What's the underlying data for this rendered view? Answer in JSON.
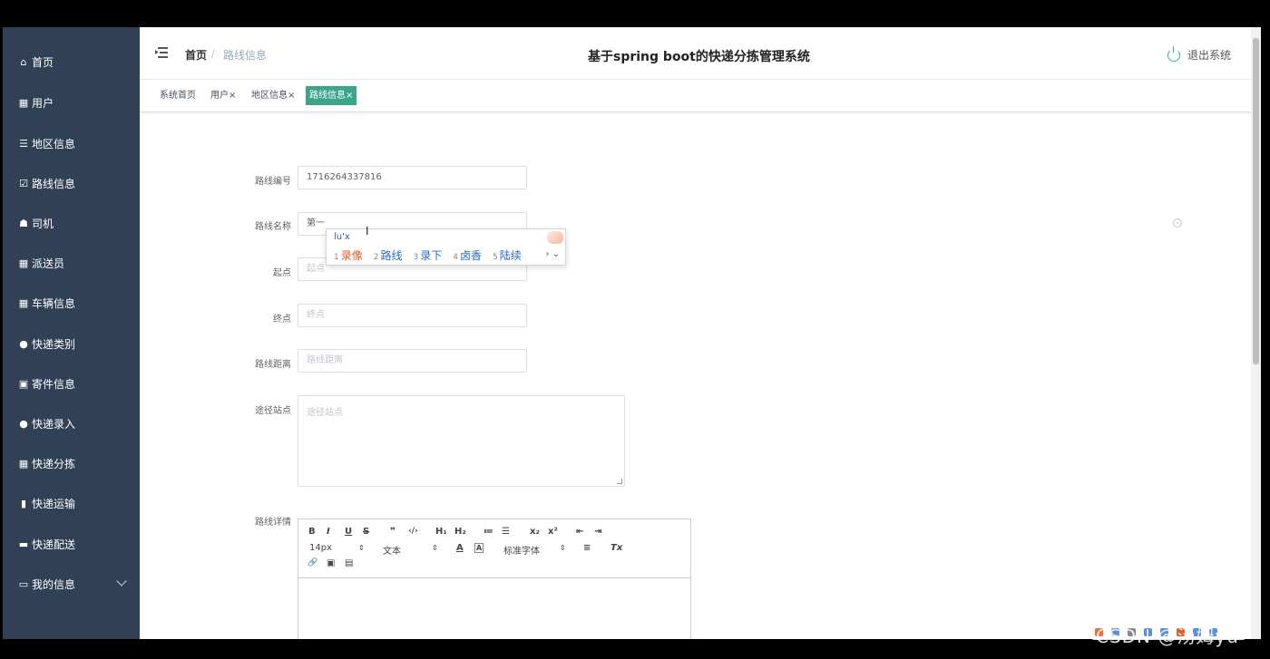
{
  "sidebar": {
    "items": [
      {
        "label": "首页",
        "icon": "home-icon"
      },
      {
        "label": "用户",
        "icon": "grid-icon"
      },
      {
        "label": "地区信息",
        "icon": "list-icon"
      },
      {
        "label": "路线信息",
        "icon": "checkbox-icon"
      },
      {
        "label": "司机",
        "icon": "thumb-icon"
      },
      {
        "label": "派送员",
        "icon": "grid-icon"
      },
      {
        "label": "车辆信息",
        "icon": "grid-icon"
      },
      {
        "label": "快递类别",
        "icon": "user-icon"
      },
      {
        "label": "寄件信息",
        "icon": "clipboard-icon"
      },
      {
        "label": "快递录入",
        "icon": "user-icon"
      },
      {
        "label": "快递分拣",
        "icon": "grid-icon"
      },
      {
        "label": "快递运输",
        "icon": "bar-chart-icon"
      },
      {
        "label": "快递配送",
        "icon": "ticket-icon"
      },
      {
        "label": "我的信息",
        "icon": "card-icon"
      }
    ]
  },
  "header": {
    "breadcrumb_home": "首页",
    "breadcrumb_sep": "/",
    "breadcrumb_current": "路线信息",
    "title": "基于spring boot的快递分拣管理系统",
    "logout_label": "退出系统"
  },
  "tabs": [
    {
      "label": "系统首页",
      "closable": false,
      "active": false
    },
    {
      "label": "用户",
      "closable": true,
      "active": false
    },
    {
      "label": "地区信息",
      "closable": true,
      "active": false
    },
    {
      "label": "路线信息",
      "closable": true,
      "active": true
    }
  ],
  "tab_close_glyph": "×",
  "form": {
    "route_no": {
      "label": "路线编号",
      "value": "1716264337816"
    },
    "route_name": {
      "label": "路线名称",
      "value": "第一"
    },
    "start": {
      "label": "起点",
      "placeholder": "起点"
    },
    "end": {
      "label": "终点",
      "placeholder": "终点"
    },
    "distance": {
      "label": "路线距离",
      "placeholder": "路线距离"
    },
    "stations": {
      "label": "途径站点",
      "placeholder": "途径站点"
    },
    "details": {
      "label": "路线详情"
    }
  },
  "editor": {
    "row1": [
      "B",
      "I",
      "U",
      "S",
      "❞",
      "‹/›",
      "H₁",
      "H₂",
      "≔",
      "☰",
      "x₂",
      "x²",
      "⇤",
      "⇥"
    ],
    "font_size": "14px",
    "block_type": "文本",
    "font_family": "标准字体",
    "row2_icons": [
      "A",
      "A",
      "≡",
      "Tx"
    ],
    "row3_icons": [
      "🔗",
      "▣",
      "▤"
    ]
  },
  "ime": {
    "composition": "lu'x",
    "candidates": [
      {
        "n": "1",
        "text": "录像"
      },
      {
        "n": "2",
        "text": "路线"
      },
      {
        "n": "3",
        "text": "录下"
      },
      {
        "n": "4",
        "text": "卤香"
      },
      {
        "n": "5",
        "text": "陆续"
      }
    ],
    "nav": "› ⌄"
  },
  "watermark": "CSDN @汤姆yu",
  "colors": {
    "sidebar_bg": "#304156",
    "accent": "#3ba58a",
    "ime_first": "#e05a2b",
    "ime_cand": "#2a6ac4"
  }
}
